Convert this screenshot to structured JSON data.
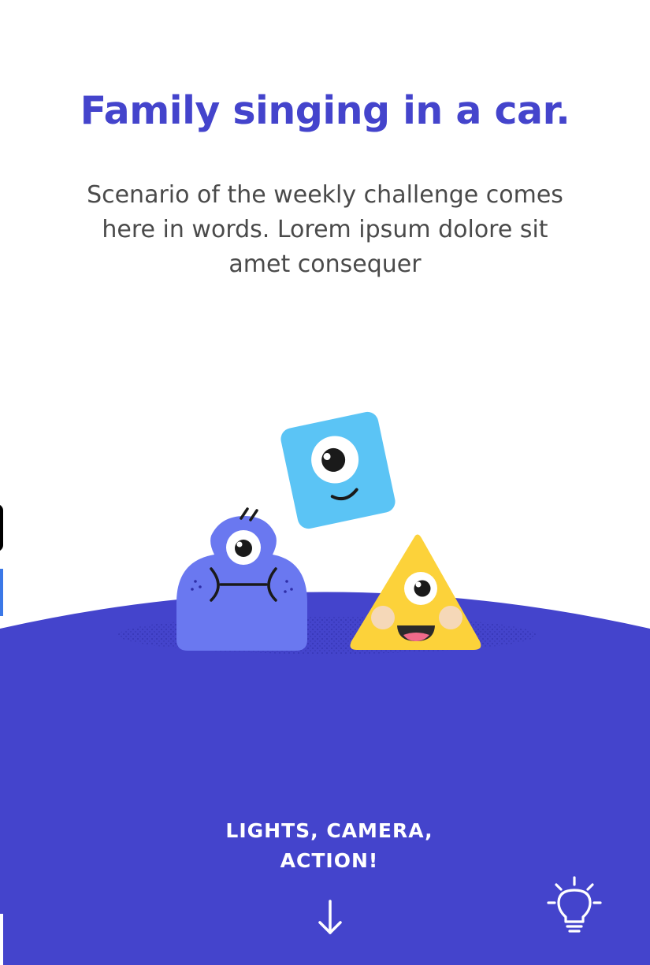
{
  "challenge": {
    "title": "Family singing in a car.",
    "description": "Scenario of the weekly challenge comes here in words. Lorem ipsum dolore sit amet consequer"
  },
  "cta": {
    "label_line1": "LIGHTS, CAMERA,",
    "label_line2": "ACTION!"
  },
  "icons": {
    "down_arrow": "arrow-down-icon",
    "idea": "lightbulb-icon"
  },
  "colors": {
    "brand": "#4444cc",
    "text_gray": "#4a4a4a",
    "square_monster": "#5bc4f5",
    "blob_monster": "#6a78f0",
    "triangle_monster": "#fcd23a",
    "white": "#ffffff"
  }
}
